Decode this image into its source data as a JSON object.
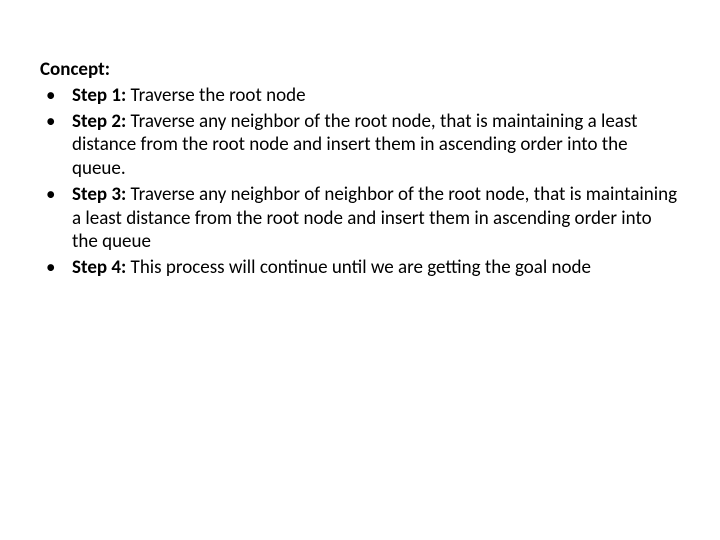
{
  "heading": "Concept:",
  "steps": [
    {
      "label": "Step 1:",
      "text": " Traverse the root node"
    },
    {
      "label": "Step 2:",
      "text": " Traverse any neighbor of the root node, that is maintaining a least distance from the root node and insert them in ascending order into the queue."
    },
    {
      "label": "Step 3:",
      "text": " Traverse any neighbor of neighbor of the root node, that is maintaining a least distance from the root node and insert them in ascending order into the queue"
    },
    {
      "label": "Step 4:",
      "text": " This process will continue until we are getting the goal node"
    }
  ]
}
